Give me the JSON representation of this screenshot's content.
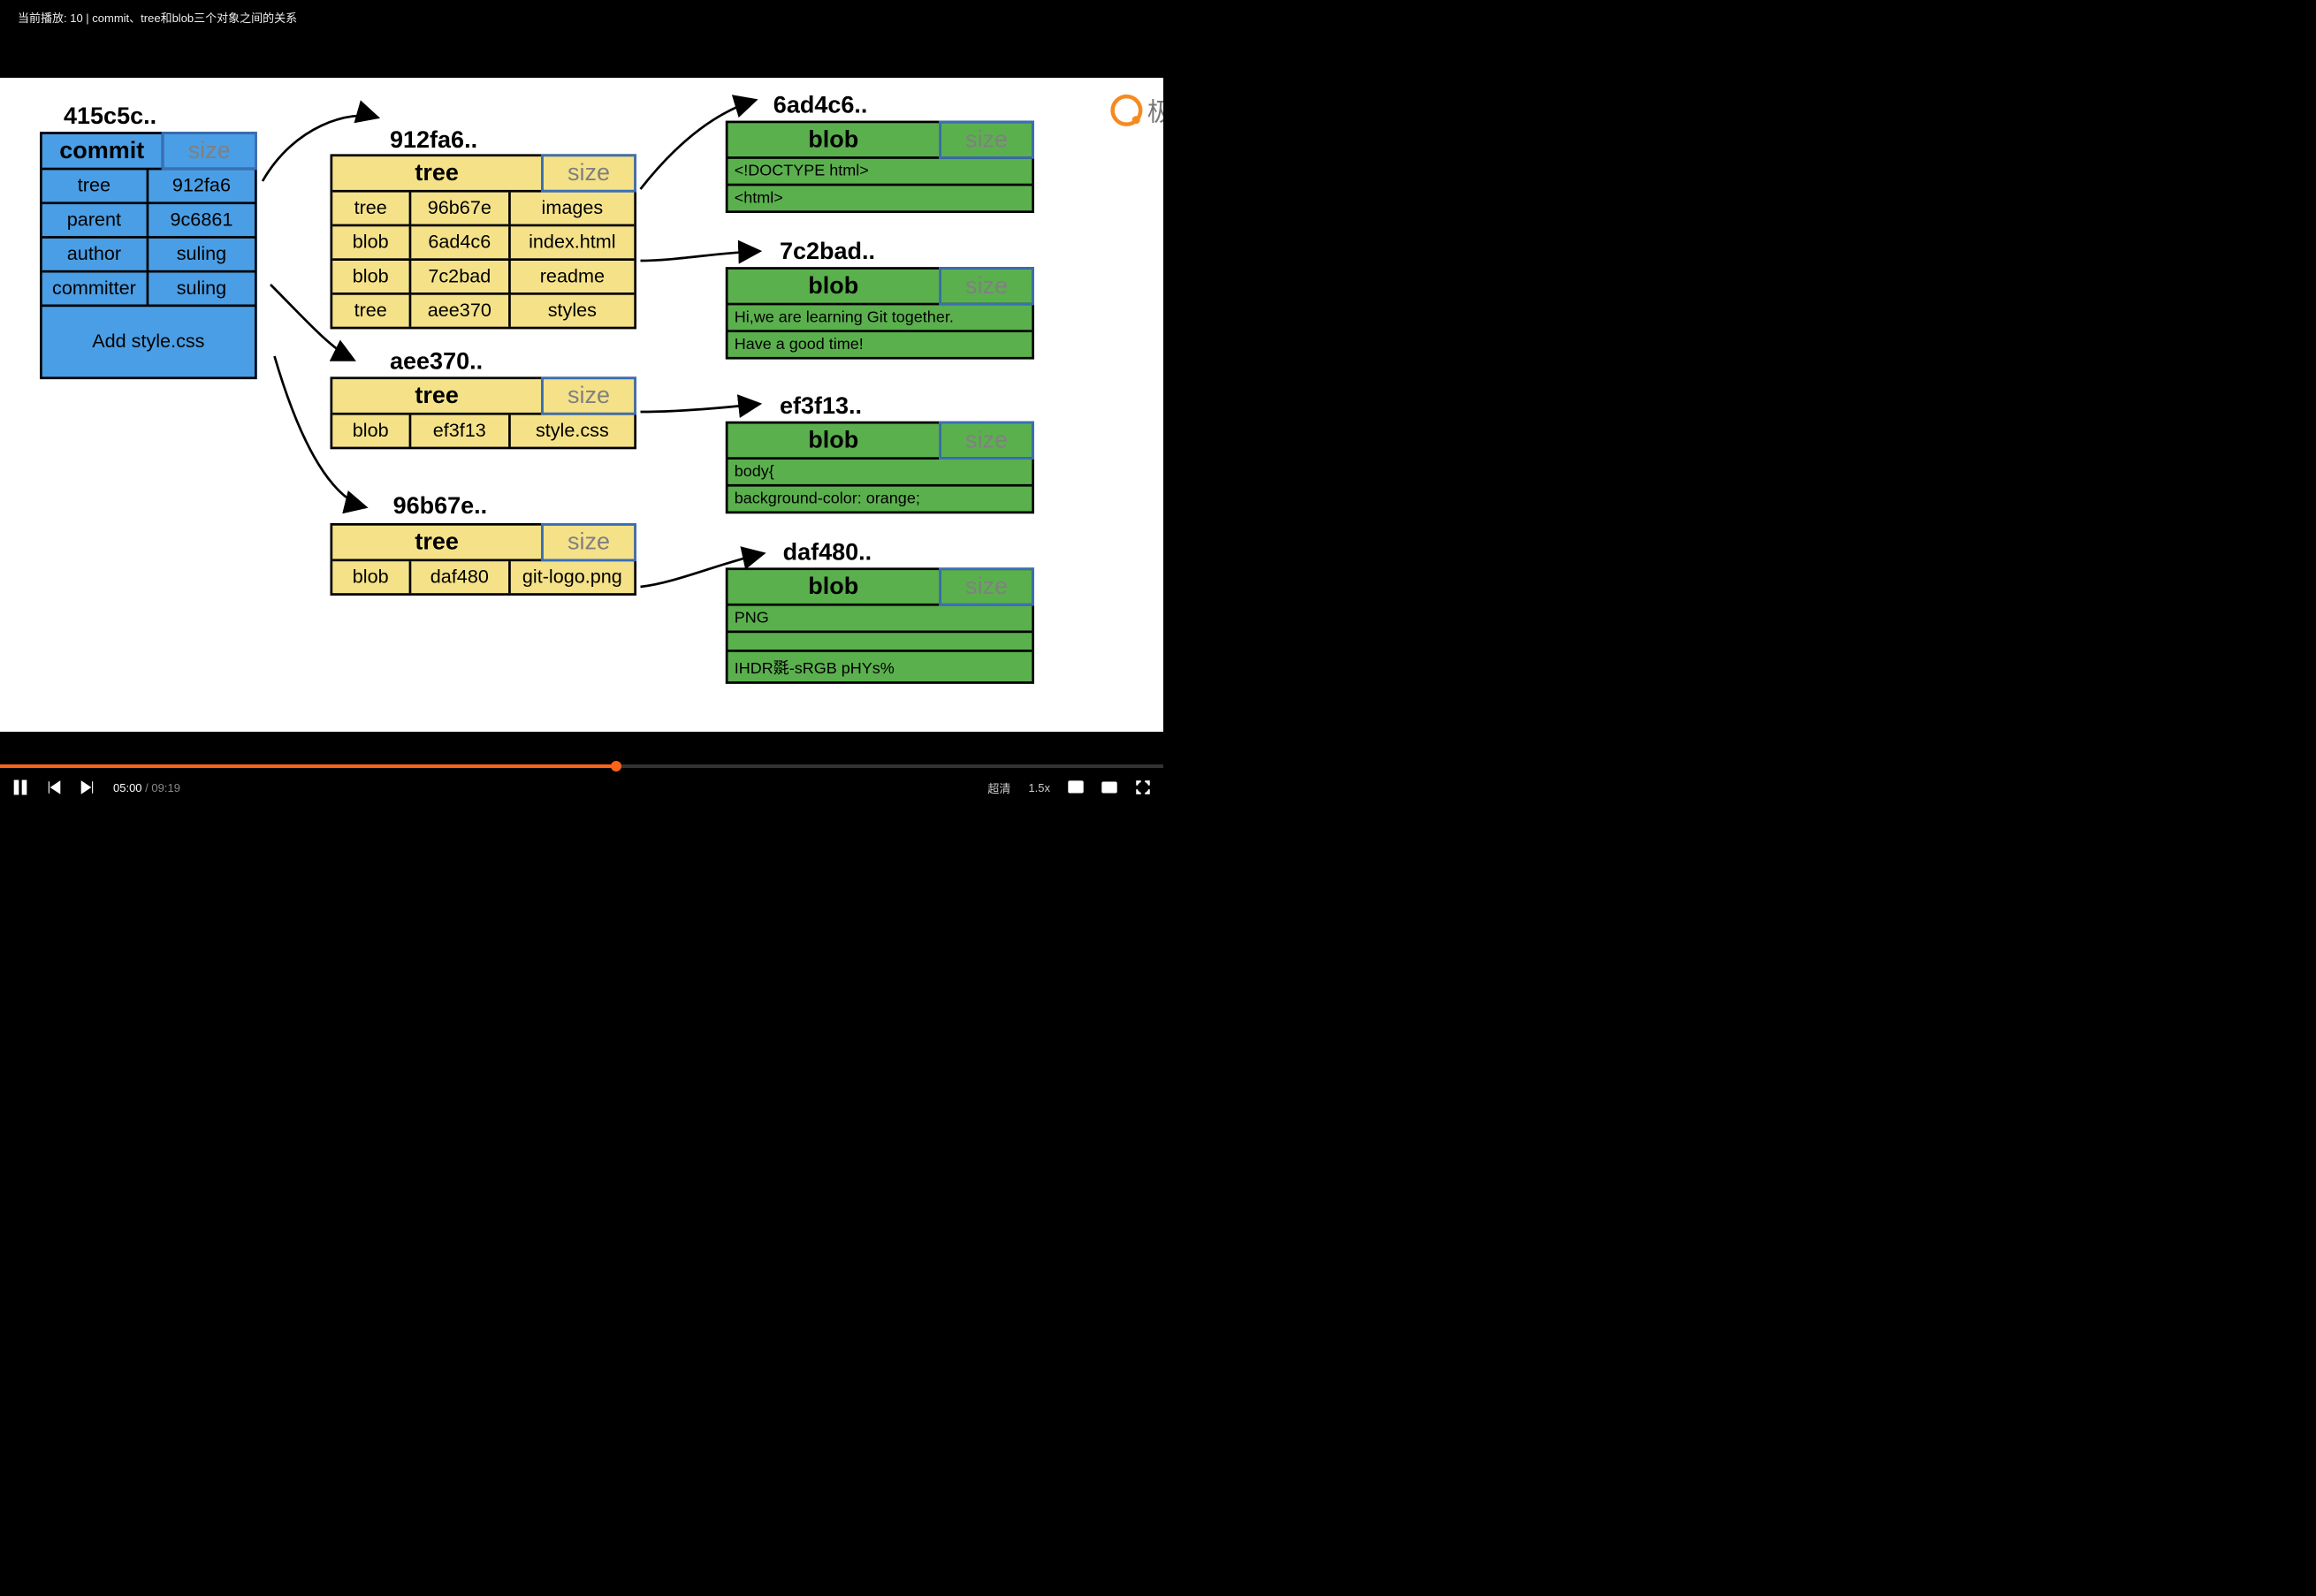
{
  "topbar": {
    "title": "当前播放: 10 | commit、tree和blob三个对象之间的关系"
  },
  "logo": {
    "text": "极客时间"
  },
  "commit": {
    "hash": "415c5c..",
    "type_label": "commit",
    "size_label": "size",
    "rows": [
      {
        "k": "tree",
        "v": "912fa6"
      },
      {
        "k": "parent",
        "v": "9c6861"
      },
      {
        "k": "author",
        "v": "suling"
      },
      {
        "k": "committer",
        "v": "suling"
      }
    ],
    "message": "Add style.css"
  },
  "trees": [
    {
      "hash": "912fa6..",
      "type_label": "tree",
      "size_label": "size",
      "rows": [
        {
          "a": "tree",
          "b": "96b67e",
          "c": "images"
        },
        {
          "a": "blob",
          "b": "6ad4c6",
          "c": "index.html"
        },
        {
          "a": "blob",
          "b": "7c2bad",
          "c": "readme"
        },
        {
          "a": "tree",
          "b": "aee370",
          "c": "styles"
        }
      ]
    },
    {
      "hash": "aee370..",
      "type_label": "tree",
      "size_label": "size",
      "rows": [
        {
          "a": "blob",
          "b": "ef3f13",
          "c": "style.css"
        }
      ]
    },
    {
      "hash": "96b67e..",
      "type_label": "tree",
      "size_label": "size",
      "rows": [
        {
          "a": "blob",
          "b": "daf480",
          "c": "git-logo.png"
        }
      ]
    }
  ],
  "blobs": [
    {
      "hash": "6ad4c6..",
      "type_label": "blob",
      "size_label": "size",
      "lines": [
        "<!DOCTYPE html>",
        "<html>"
      ]
    },
    {
      "hash": "7c2bad..",
      "type_label": "blob",
      "size_label": "size",
      "lines": [
        "Hi,we are learning Git together.",
        "Have a good time!"
      ]
    },
    {
      "hash": "ef3f13..",
      "type_label": "blob",
      "size_label": "size",
      "lines": [
        "body{",
        " background-color: orange;"
      ]
    },
    {
      "hash": "daf480..",
      "type_label": "blob",
      "size_label": "size",
      "lines": [
        "PNG",
        "",
        "IHDR毲-sRGB pHYs%"
      ]
    }
  ],
  "player": {
    "current": "05:00",
    "duration": "09:19",
    "progress_pct": 53,
    "quality": "超清",
    "speed": "1.5x"
  }
}
